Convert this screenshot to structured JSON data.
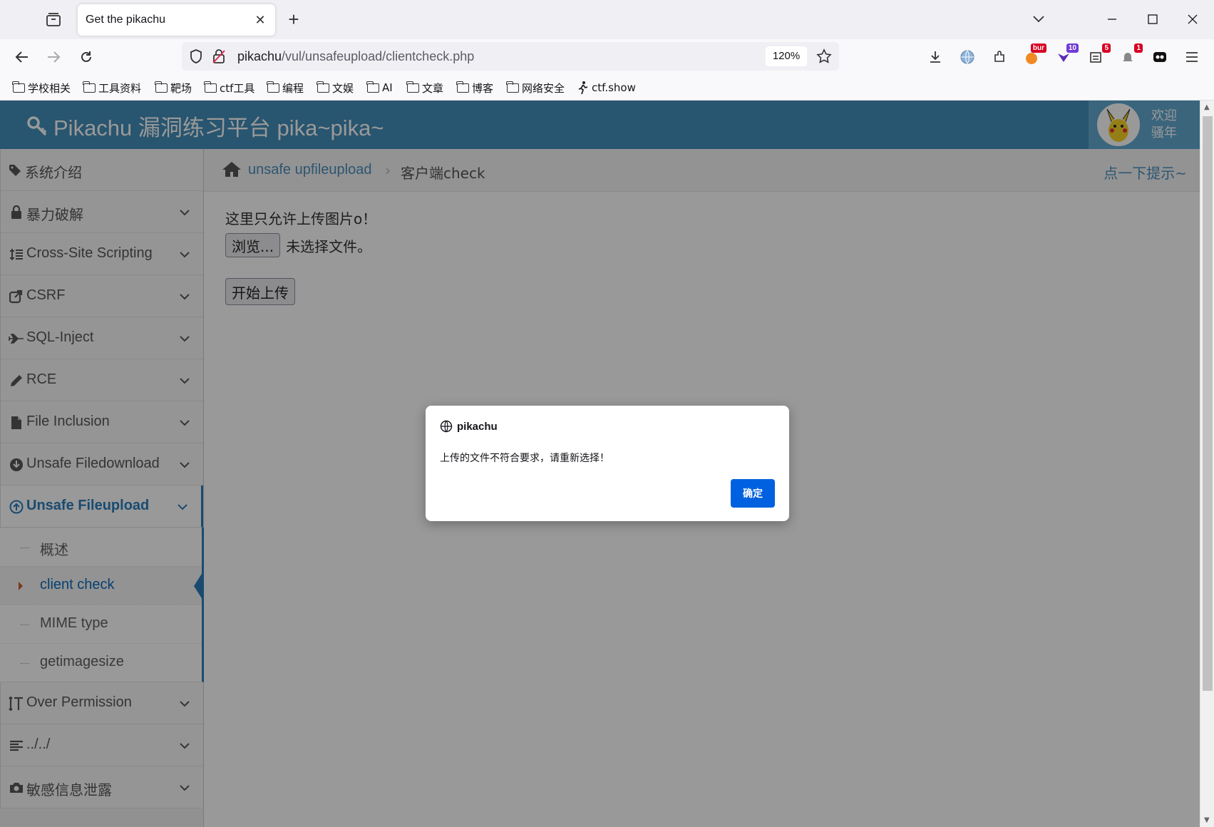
{
  "browser": {
    "tab_title": "Get the pikachu",
    "url_host": "pikachu",
    "url_path": "/vul/unsafeupload/clientcheck.php",
    "zoom": "120%",
    "extension_badges": {
      "burp": "bur",
      "ext10": "10",
      "ext5": "5",
      "ext1": "1"
    },
    "bookmarks": [
      "学校相关",
      "工具资料",
      "靶场",
      "ctf工具",
      "编程",
      "文娱",
      "AI",
      "文章",
      "博客",
      "网络安全",
      "ctf.show"
    ]
  },
  "header": {
    "logo_text": "Pikachu 漏洞练习平台 pika~pika~",
    "welcome_line1": "欢迎",
    "welcome_line2": "骚年"
  },
  "sidebar": {
    "items": [
      {
        "label": "系统介绍",
        "icon": "tags-icon"
      },
      {
        "label": "暴力破解",
        "icon": "lock-icon"
      },
      {
        "label": "Cross-Site Scripting",
        "icon": "list-icon"
      },
      {
        "label": "CSRF",
        "icon": "share-icon"
      },
      {
        "label": "SQL-Inject",
        "icon": "plane-icon"
      },
      {
        "label": "RCE",
        "icon": "pencil-icon"
      },
      {
        "label": "File Inclusion",
        "icon": "file-icon"
      },
      {
        "label": "Unsafe Filedownload",
        "icon": "download-icon"
      },
      {
        "label": "Unsafe Fileupload",
        "icon": "upload-icon"
      },
      {
        "label": "Over Permission",
        "icon": "text-height-icon"
      },
      {
        "label": "../../",
        "icon": "align-left-icon"
      },
      {
        "label": "敏感信息泄露",
        "icon": "camera-icon"
      }
    ],
    "subitems": [
      {
        "label": "概述"
      },
      {
        "label": "client check"
      },
      {
        "label": "MIME type"
      },
      {
        "label": "getimagesize"
      }
    ]
  },
  "breadcrumb": {
    "link": "unsafe upfileupload",
    "separator": "›",
    "current": "客户端check",
    "hint": "点一下提示~"
  },
  "content": {
    "note": "这里只允许上传图片o！",
    "browse_label": "浏览...",
    "file_status": "未选择文件。",
    "submit_label": "开始上传"
  },
  "dialog": {
    "origin": "pikachu",
    "message": "上传的文件不符合要求，请重新选择！",
    "ok_label": "确定"
  },
  "colors": {
    "header_bg": "#438eb9",
    "accent": "#2b7dbc",
    "dialog_button": "#0061e0"
  }
}
